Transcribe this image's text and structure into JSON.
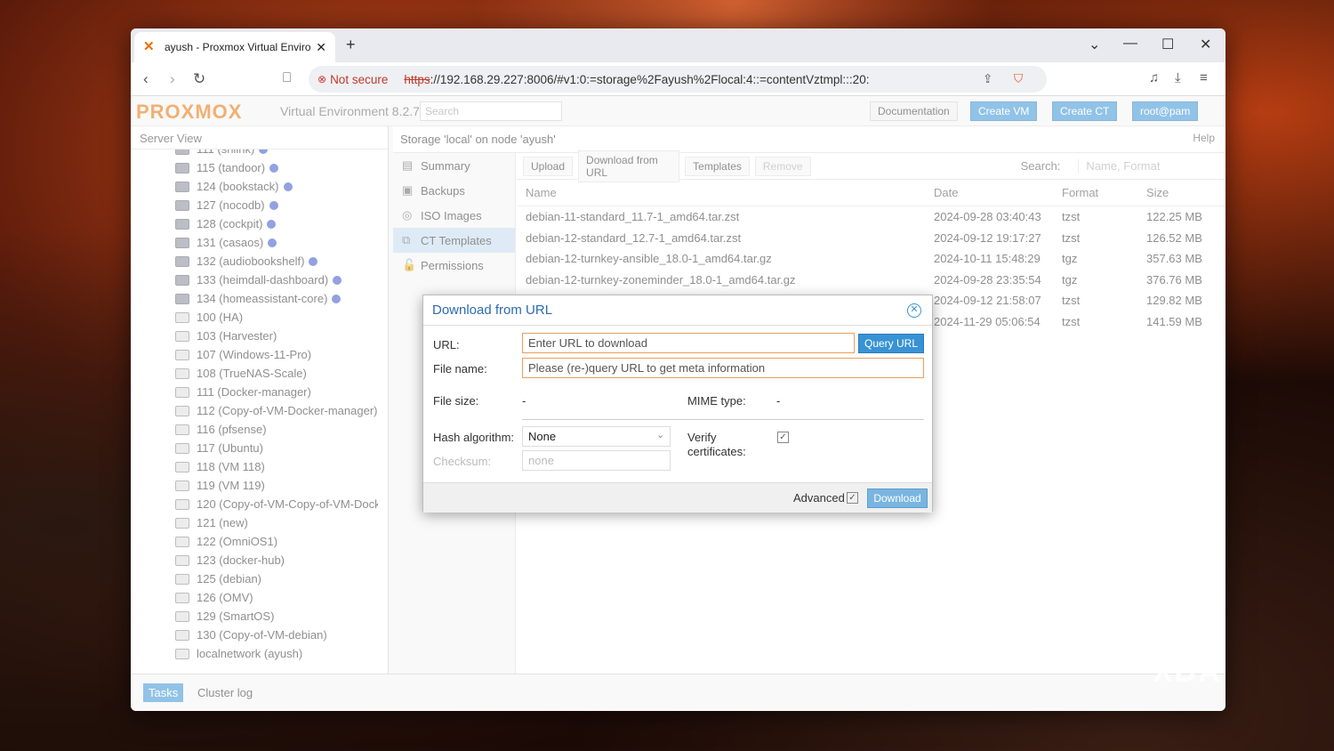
{
  "browser": {
    "tab_title": "ayush - Proxmox Virtual Enviro",
    "not_secure": "Not secure",
    "url_scheme": "https",
    "url_rest": "://192.168.29.227:8006/#v1:0:=storage%2Fayush%2Flocal:4::=contentVztmpl:::20:"
  },
  "pve": {
    "logo": "PROXMOX",
    "version": "Virtual Environment 8.2.7",
    "search_placeholder": "Search",
    "docs": "Documentation",
    "create_vm": "Create VM",
    "create_ct": "Create CT",
    "user": "root@pam",
    "server_view": "Server View"
  },
  "tree": [
    "111 (shlink)",
    "115 (tandoor)",
    "124 (bookstack)",
    "127 (nocodb)",
    "128 (cockpit)",
    "131 (casaos)",
    "132 (audiobookshelf)",
    "133 (heimdall-dashboard)",
    "134 (homeassistant-core)",
    "100 (HA)",
    "103 (Harvester)",
    "107 (Windows-11-Pro)",
    "108 (TrueNAS-Scale)",
    "111 (Docker-manager)",
    "112 (Copy-of-VM-Docker-manager)",
    "116 (pfsense)",
    "117 (Ubuntu)",
    "118 (VM 118)",
    "119 (VM 119)",
    "120 (Copy-of-VM-Copy-of-VM-Docke",
    "121 (new)",
    "122 (OmniOS1)",
    "123 (docker-hub)",
    "125 (debian)",
    "126 (OMV)",
    "129 (SmartOS)",
    "130 (Copy-of-VM-debian)",
    "localnetwork (ayush)"
  ],
  "breadcrumb": "Storage 'local' on node 'ayush'",
  "help": "Help",
  "subnav": [
    "Summary",
    "Backups",
    "ISO Images",
    "CT Templates",
    "Permissions"
  ],
  "grid": {
    "buttons": [
      "Upload",
      "Download from URL",
      "Templates",
      "Remove"
    ],
    "search_label": "Search:",
    "search_placeholder": "Name, Format",
    "headers": [
      "Name",
      "Date",
      "Format",
      "Size"
    ],
    "rows": [
      [
        "debian-11-standard_11.7-1_amd64.tar.zst",
        "2024-09-28 03:40:43",
        "tzst",
        "122.25 MB"
      ],
      [
        "debian-12-standard_12.7-1_amd64.tar.zst",
        "2024-09-12 19:17:27",
        "tzst",
        "126.52 MB"
      ],
      [
        "debian-12-turnkey-ansible_18.0-1_amd64.tar.gz",
        "2024-10-11 15:48:29",
        "tgz",
        "357.63 MB"
      ],
      [
        "debian-12-turnkey-zoneminder_18.0-1_amd64.tar.gz",
        "2024-09-28 23:35:54",
        "tgz",
        "376.76 MB"
      ],
      [
        "",
        "2024-09-12 21:58:07",
        "tzst",
        "129.82 MB"
      ],
      [
        "",
        "2024-11-29 05:06:54",
        "tzst",
        "141.59 MB"
      ]
    ]
  },
  "bottom": {
    "tasks": "Tasks",
    "cluster_log": "Cluster log"
  },
  "dialog": {
    "title": "Download from URL",
    "url_label": "URL:",
    "url_placeholder": "Enter URL to download",
    "query_btn": "Query URL",
    "file_label": "File name:",
    "file_placeholder": "Please (re-)query URL to get meta information",
    "size_label": "File size:",
    "size_val": "-",
    "mime_label": "MIME type:",
    "mime_val": "-",
    "hash_label": "Hash algorithm:",
    "hash_val": "None",
    "verify_label": "Verify",
    "verify_label2": "certificates:",
    "checksum_label": "Checksum:",
    "checksum_placeholder": "none",
    "advanced": "Advanced",
    "download": "Download"
  },
  "watermark": "XDA"
}
